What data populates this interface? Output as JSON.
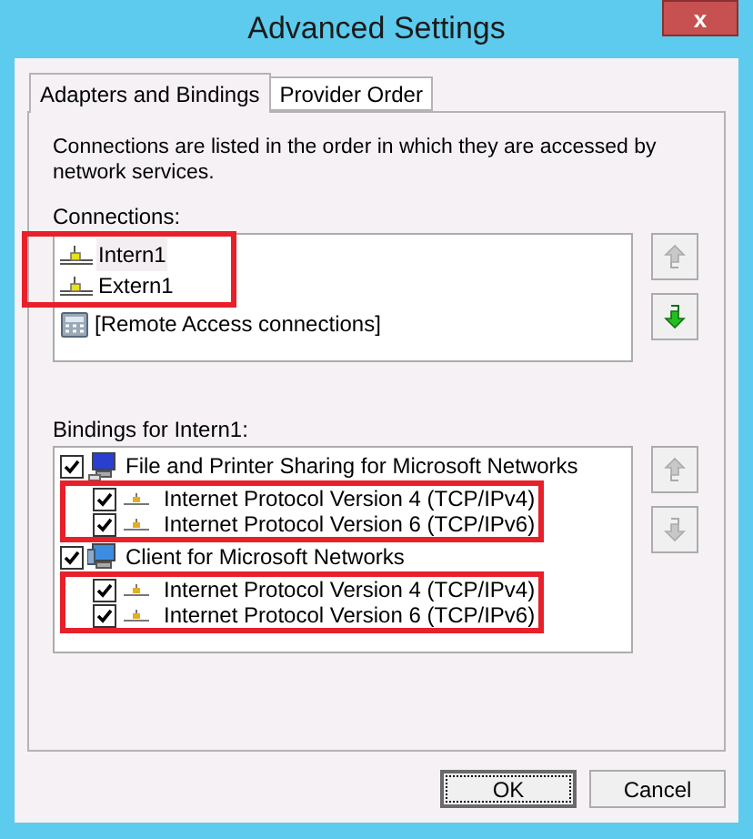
{
  "window": {
    "title": "Advanced Settings",
    "close": "x"
  },
  "tabs": [
    {
      "label": "Adapters and Bindings",
      "selected": true
    },
    {
      "label": "Provider Order",
      "selected": false
    }
  ],
  "description": "Connections are listed in the order in which they are accessed by network services.",
  "connections": {
    "label": "Connections:",
    "items": [
      {
        "name": "Intern1",
        "kind": "adapter",
        "highlighted": true
      },
      {
        "name": "Extern1",
        "kind": "adapter",
        "highlighted": true
      },
      {
        "name": "[Remote Access connections]",
        "kind": "remote",
        "highlighted": false
      }
    ],
    "move_up": {
      "disabled": true
    },
    "move_down": {
      "disabled": false
    }
  },
  "bindings": {
    "label": "Bindings for Intern1:",
    "items": [
      {
        "name": "File and Printer Sharing for Microsoft Networks",
        "kind": "sharing",
        "checked": true,
        "highlight_children": true,
        "children": [
          {
            "name": "Internet Protocol Version 4 (TCP/IPv4)",
            "checked": true
          },
          {
            "name": "Internet Protocol Version 6 (TCP/IPv6)",
            "checked": true
          }
        ]
      },
      {
        "name": "Client for Microsoft Networks",
        "kind": "client",
        "checked": true,
        "highlight_children": true,
        "children": [
          {
            "name": "Internet Protocol Version 4 (TCP/IPv4)",
            "checked": true
          },
          {
            "name": "Internet Protocol Version 6 (TCP/IPv6)",
            "checked": true
          }
        ]
      }
    ],
    "move_up": {
      "disabled": true
    },
    "move_down": {
      "disabled": true
    }
  },
  "buttons": [
    {
      "label": "OK",
      "default": true
    },
    {
      "label": "Cancel",
      "default": false
    }
  ]
}
